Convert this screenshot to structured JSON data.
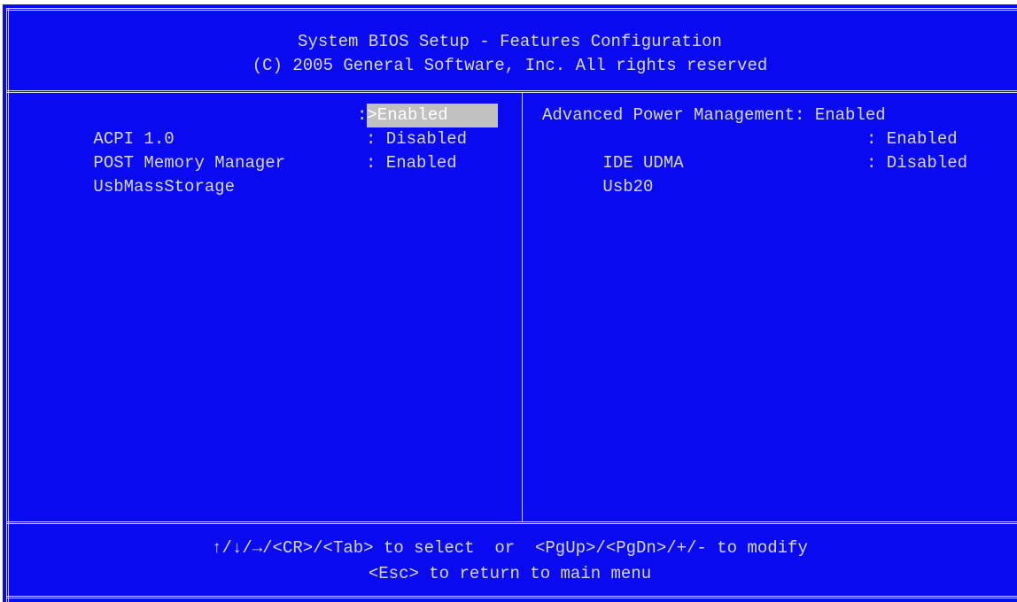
{
  "header": {
    "title": "System BIOS Setup - Features Configuration",
    "copyright": "(C) 2005 General Software, Inc. All rights reserved"
  },
  "left_panel": {
    "items": [
      {
        "label": "ACPI 1.0",
        "separator": ":",
        "value": ">Enabled",
        "selected": true
      },
      {
        "label": "POST Memory Manager",
        "separator": ":",
        "value": " Disabled",
        "selected": false
      },
      {
        "label": "UsbMassStorage",
        "separator": ":",
        "value": " Enabled",
        "selected": false
      }
    ]
  },
  "right_panel": {
    "items": [
      {
        "label": "Advanced Power Management",
        "separator": ":",
        "value": " Enabled"
      },
      {
        "label": "IDE UDMA",
        "separator": ":",
        "value": " Enabled"
      },
      {
        "label": "Usb20",
        "separator": ":",
        "value": " Disabled"
      }
    ]
  },
  "footer": {
    "line1": "↑/↓/→/<CR>/<Tab> to select  or  <PgUp>/<PgDn>/+/- to modify",
    "line2": "<Esc> to return to main menu"
  },
  "colors": {
    "background": "#0a0af2",
    "text": "#d8d8d8",
    "highlight": "#c0c0c0"
  }
}
